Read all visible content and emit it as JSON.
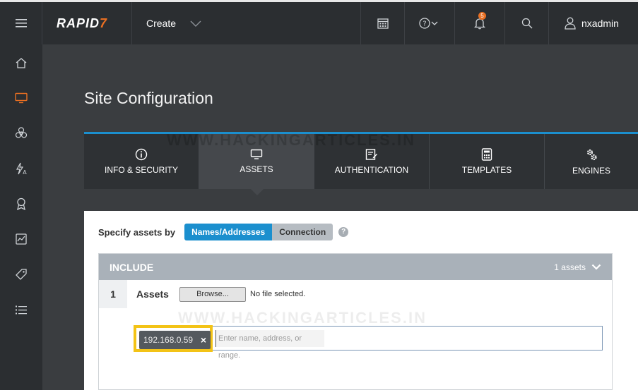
{
  "topbar": {
    "logo_main": "RAPID",
    "logo_suffix": "7",
    "create_label": "Create",
    "notifications_count": "5",
    "username": "nxadmin"
  },
  "page": {
    "title": "Site Configuration",
    "watermark": "WWW.HACKINGARTICLES.IN"
  },
  "tabs": [
    {
      "label": "INFO & SECURITY"
    },
    {
      "label": "ASSETS"
    },
    {
      "label": "AUTHENTICATION"
    },
    {
      "label": "TEMPLATES"
    },
    {
      "label": "ENGINES"
    }
  ],
  "specify": {
    "label": "Specify assets by",
    "option_names": "Names/Addresses",
    "option_connection": "Connection",
    "help": "?"
  },
  "include": {
    "title": "INCLUDE",
    "count": "1 assets",
    "row_number": "1",
    "assets_label": "Assets",
    "browse_label": "Browse...",
    "no_file": "No file selected.",
    "tag_value": "192.168.0.59",
    "tag_remove": "×",
    "input_placeholder": "Enter name, address, or range."
  },
  "colors": {
    "accent": "#1b8fce",
    "brand_orange": "#e96f22",
    "highlight": "#f3c316"
  }
}
